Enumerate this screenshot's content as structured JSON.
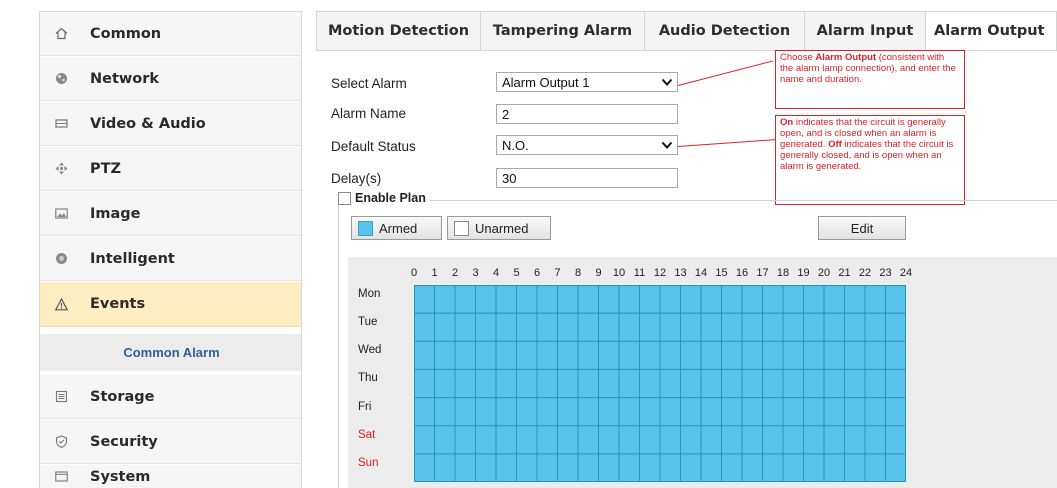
{
  "sidebar": {
    "items": [
      {
        "label": "Common",
        "icon": "home-icon"
      },
      {
        "label": "Network",
        "icon": "network-icon"
      },
      {
        "label": "Video & Audio",
        "icon": "video-audio-icon"
      },
      {
        "label": "PTZ",
        "icon": "ptz-icon"
      },
      {
        "label": "Image",
        "icon": "image-icon"
      },
      {
        "label": "Intelligent",
        "icon": "intelligent-icon"
      },
      {
        "label": "Events",
        "icon": "warning-icon",
        "active": true
      },
      {
        "label": "Storage",
        "icon": "storage-icon"
      },
      {
        "label": "Security",
        "icon": "shield-icon"
      },
      {
        "label": "System",
        "icon": "system-icon"
      }
    ],
    "sub_item": "Common Alarm"
  },
  "tabs": [
    {
      "label": "Motion Detection"
    },
    {
      "label": "Tampering Alarm"
    },
    {
      "label": "Audio Detection"
    },
    {
      "label": "Alarm Input"
    },
    {
      "label": "Alarm Output",
      "active": true
    }
  ],
  "form": {
    "select_alarm": {
      "label": "Select Alarm",
      "value": "Alarm Output 1"
    },
    "alarm_name": {
      "label": "Alarm Name",
      "value": "2"
    },
    "default_status": {
      "label": "Default Status",
      "value": "N.O."
    },
    "delay": {
      "label": "Delay(s)",
      "value": "30"
    }
  },
  "callouts": {
    "alarm_output": {
      "prefix": "Choose ",
      "bold": "Alarm Output",
      "rest": " (consistent with the alarm lamp connection), and enter the name and duration."
    },
    "default_status": {
      "on_bold": "On",
      "on_text": " indicates that the circuit is generally open, and is closed when an alarm is generated. ",
      "off_bold": "Off",
      "off_text": " indicates that the circuit is generally closed, and is open when an alarm is generated."
    }
  },
  "plan": {
    "enable_label": "Enable Plan",
    "enabled": false,
    "armed_label": "Armed",
    "unarmed_label": "Unarmed",
    "edit_label": "Edit",
    "hours": [
      "0",
      "1",
      "2",
      "3",
      "4",
      "5",
      "6",
      "7",
      "8",
      "9",
      "10",
      "11",
      "12",
      "13",
      "14",
      "15",
      "16",
      "17",
      "18",
      "19",
      "20",
      "21",
      "22",
      "23",
      "24"
    ],
    "days": [
      {
        "label": "Mon",
        "weekend": false
      },
      {
        "label": "Tue",
        "weekend": false
      },
      {
        "label": "Wed",
        "weekend": false
      },
      {
        "label": "Thu",
        "weekend": false
      },
      {
        "label": "Fri",
        "weekend": false
      },
      {
        "label": "Sat",
        "weekend": true
      },
      {
        "label": "Sun",
        "weekend": true
      }
    ]
  },
  "colors": {
    "armed": "#57c3e8",
    "grid_line": "#2b8fc0",
    "active_nav": "#fdeec2",
    "sub_item_text": "#2f5e97",
    "callout": "#d9222a",
    "weekend": "#e02020"
  }
}
